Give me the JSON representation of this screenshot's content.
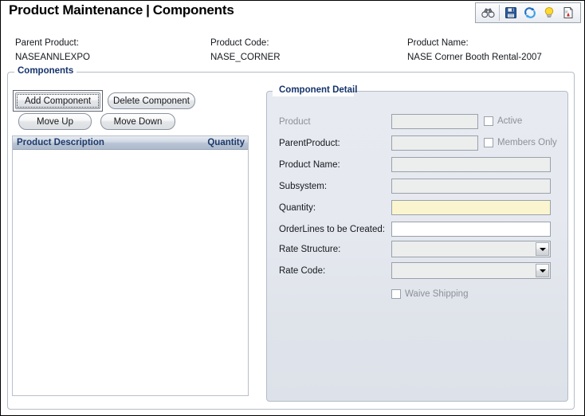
{
  "window": {
    "title_main": "Product Maintenance",
    "title_separator": "|",
    "title_section": "Components"
  },
  "toolbar": {
    "items": [
      {
        "name": "binoculars-icon",
        "label": "Search"
      },
      {
        "name": "save-icon",
        "label": "Save"
      },
      {
        "name": "refresh-icon",
        "label": "Refresh"
      },
      {
        "name": "lightbulb-icon",
        "label": "Hint"
      },
      {
        "name": "report-icon",
        "label": "Report"
      }
    ]
  },
  "header": {
    "parent_product_label": "Parent Product:",
    "parent_product_value": "NASEANNLEXPO",
    "product_code_label": "Product Code:",
    "product_code_value": "NASE_CORNER",
    "product_name_label": "Product Name:",
    "product_name_value": "NASE Corner Booth Rental-2007"
  },
  "components_panel": {
    "legend": "Components",
    "buttons": {
      "add": "Add Component",
      "delete": "Delete Component",
      "move_up": "Move Up",
      "move_down": "Move Down"
    },
    "list": {
      "columns": [
        "Product Description",
        "Quantity"
      ],
      "rows": []
    }
  },
  "detail_panel": {
    "legend": "Component Detail",
    "fields": {
      "product": {
        "label": "Product",
        "value": "",
        "state": "readonly"
      },
      "parent_product": {
        "label": "ParentProduct:",
        "value": "",
        "state": "readonly"
      },
      "product_name": {
        "label": "Product Name:",
        "value": "",
        "state": "readonly"
      },
      "subsystem": {
        "label": "Subsystem:",
        "value": "",
        "state": "readonly"
      },
      "quantity": {
        "label": "Quantity:",
        "value": "",
        "state": "required"
      },
      "order_lines": {
        "label": "OrderLines to be Created:",
        "value": "",
        "state": "editable"
      },
      "rate_structure": {
        "label": "Rate Structure:",
        "value": "",
        "state": "readonly"
      },
      "rate_code": {
        "label": "Rate Code:",
        "value": "",
        "state": "readonly"
      }
    },
    "checkboxes": {
      "active": {
        "label": "Active",
        "checked": false
      },
      "members_only": {
        "label": "Members Only",
        "checked": false
      },
      "waive_shipping": {
        "label": "Waive Shipping",
        "checked": false
      }
    }
  },
  "colors": {
    "legend_blue": "#16336b",
    "list_header_text": "#1e3a6b",
    "required_field_bg": "#fbf5cf",
    "readonly_field_bg": "#eceded",
    "panel_bg": "#e4e8ef",
    "disabled_text": "#8d9097"
  }
}
